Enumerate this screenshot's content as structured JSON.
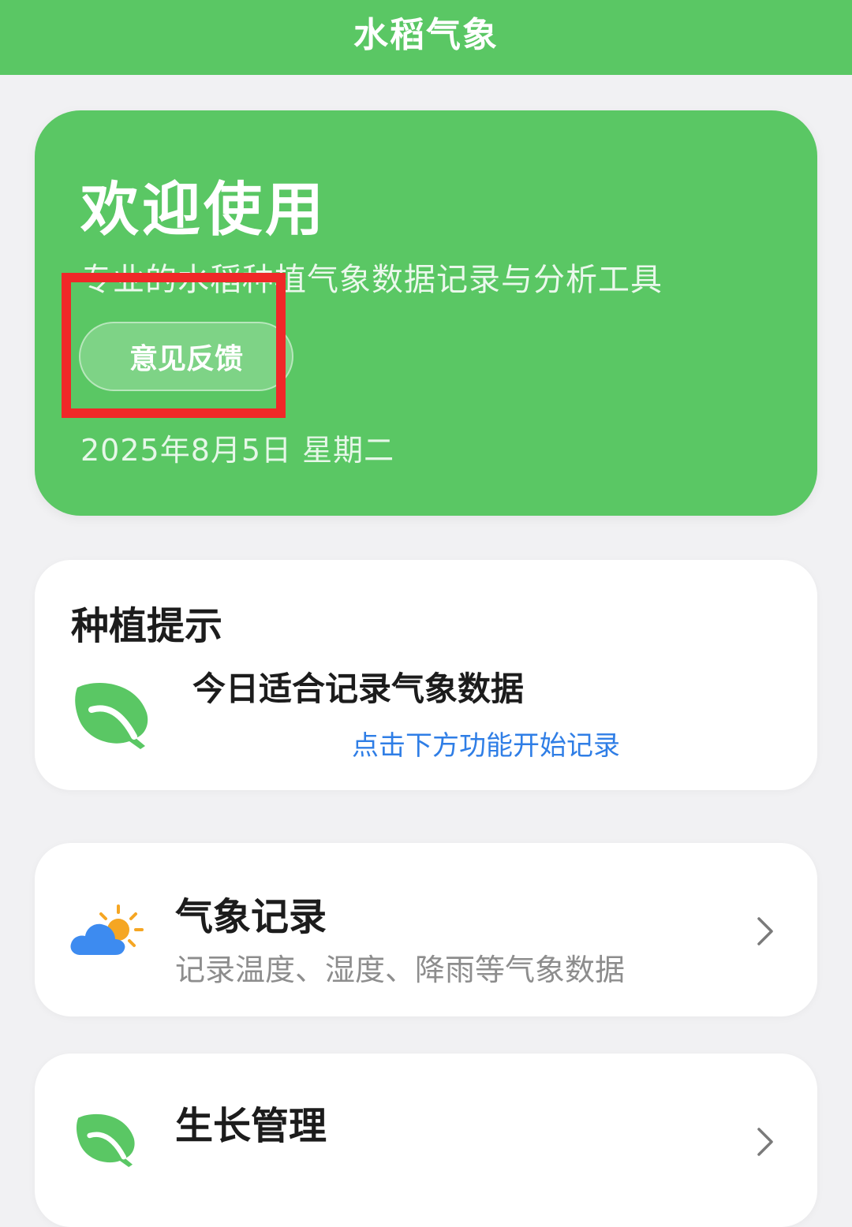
{
  "header": {
    "title": "水稻气象"
  },
  "hero": {
    "welcome": "欢迎使用",
    "subtitle": "专业的水稻种植气象数据记录与分析工具",
    "feedback_button": "意见反馈",
    "date": "2025年8月5日 星期二"
  },
  "tips": {
    "heading": "种植提示",
    "icon": "leaf-icon",
    "main_text": "今日适合记录气象数据",
    "link_text": "点击下方功能开始记录"
  },
  "features": [
    {
      "icon": "cloud-sun-icon",
      "name": "气象记录",
      "description": "记录温度、湿度、降雨等气象数据"
    },
    {
      "icon": "leaf-icon",
      "name": "生长管理",
      "description": ""
    }
  ],
  "colors": {
    "brand_green": "#5ac764",
    "link_blue": "#2f7ee6",
    "highlight_red": "#f02828",
    "weather_icon_blue": "#3d8bf0",
    "sun_orange": "#f5a623"
  }
}
